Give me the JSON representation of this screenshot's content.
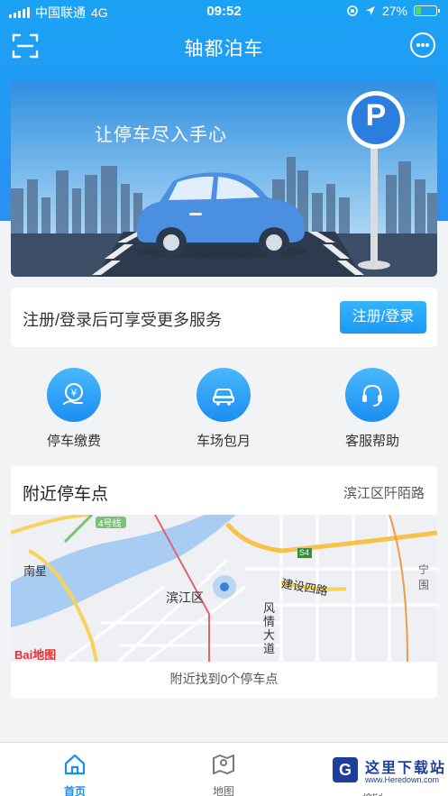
{
  "status_bar": {
    "carrier": "中国联通",
    "network": "4G",
    "time": "09:52",
    "battery": "27%"
  },
  "header": {
    "title": "轴都泊车",
    "scan_icon": "scan-icon",
    "message_icon": "chat-bubble-icon"
  },
  "banner": {
    "slogan": "让停车尽入手心",
    "parking_sign": "P"
  },
  "login_prompt": {
    "text": "注册/登录后可享受更多服务",
    "button_label": "注册/登录"
  },
  "services": [
    {
      "label": "停车缴费",
      "icon": "yuan-payment-icon"
    },
    {
      "label": "车场包月",
      "icon": "car-icon"
    },
    {
      "label": "客服帮助",
      "icon": "headset-icon"
    }
  ],
  "nearby": {
    "title": "附近停车点",
    "location": "滨江区阡陌路",
    "result": "附近找到0个停车点",
    "map": {
      "labels": [
        "4号线",
        "南星",
        "滨江区",
        "建设四路",
        "风情大道",
        "S4",
        "宁围"
      ],
      "brand": "Bai地图"
    }
  },
  "tab_bar": {
    "items": [
      {
        "label": "首页",
        "icon": "home-icon",
        "active": true
      },
      {
        "label": "地图",
        "icon": "map-icon",
        "active": false
      },
      {
        "label": "我的",
        "icon": "user-icon",
        "active": false
      }
    ]
  },
  "watermark": {
    "title": "这里下载站",
    "url": "www.Heredown.com"
  },
  "colors": {
    "primary": "#1b8ef2",
    "header_top": "#1aa3f5",
    "background": "#f2f3f5"
  }
}
